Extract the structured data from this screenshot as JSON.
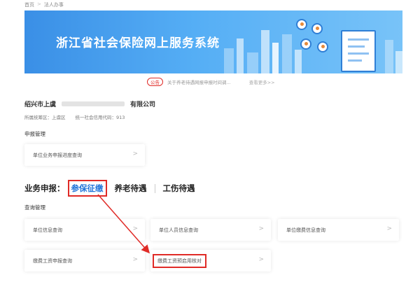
{
  "breadcrumb": {
    "home": "首页",
    "separator": ">",
    "current": "法人办事"
  },
  "banner": {
    "title": "浙江省社会保险网上服务系统"
  },
  "notice": {
    "tag": "公告",
    "text": "关于养老待遇网报申报时间调...",
    "more": "查看更多>>"
  },
  "company": {
    "name_prefix": "绍兴市上虞",
    "name_suffix": "有限公司",
    "district": "所属统筹区：上虞区",
    "credit_code": "统一社会信用代码：913"
  },
  "declare_mgmt": {
    "title": "申报管理",
    "items": [
      {
        "label": "单位业务申报进度查询"
      }
    ]
  },
  "business": {
    "prefix": "业务申报：",
    "tabs": [
      {
        "label": "参保征缴",
        "active": true
      },
      {
        "label": "养老待遇"
      },
      {
        "label": "工伤待遇"
      }
    ]
  },
  "query_mgmt": {
    "title": "查询管理",
    "items": [
      {
        "label": "单位信息查询"
      },
      {
        "label": "单位人员信息查询"
      },
      {
        "label": "单位缴费信息查询"
      },
      {
        "label": "缴费工资申报查询"
      },
      {
        "label": "缴费工资预启用核对"
      }
    ]
  },
  "chevron": ">",
  "colors": {
    "accent_blue": "#1f73d9",
    "highlight_red": "#e02b27",
    "banner_blue": "#3a8fe6"
  }
}
